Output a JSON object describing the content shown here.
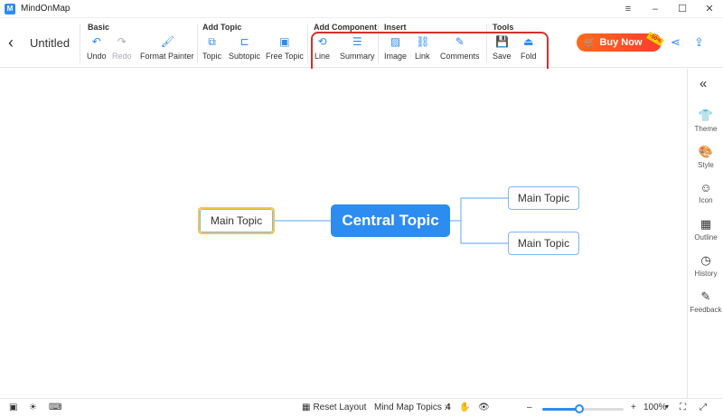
{
  "window": {
    "title": "MindOnMap",
    "logo": "M",
    "controls": [
      "≡",
      "–",
      "☐",
      "✕"
    ]
  },
  "toolbar": {
    "back_icon": "‹",
    "doc_title": "Untitled",
    "groups": {
      "basic": "Basic",
      "add_topic": "Add Topic",
      "add_component": "Add Component",
      "insert": "Insert",
      "tools": "Tools"
    },
    "tools": {
      "undo": "Undo",
      "redo": "Redo",
      "format_painter": "Format Painter",
      "topic": "Topic",
      "subtopic": "Subtopic",
      "free_topic": "Free Topic",
      "line": "Line",
      "summary": "Summary",
      "image": "Image",
      "link": "Link",
      "comments": "Comments",
      "save": "Save",
      "fold": "Fold"
    },
    "buy_now": "Buy Now",
    "discount_badge": "-50%"
  },
  "canvas": {
    "central_topic": "Central Topic",
    "left_topic": "Main Topic",
    "right_topic_1": "Main Topic",
    "right_topic_2": "Main Topic"
  },
  "rightbar": {
    "collapse_icon": "«",
    "items": [
      {
        "label": "Theme",
        "icon": "👕"
      },
      {
        "label": "Style",
        "icon": "🎨"
      },
      {
        "label": "Icon",
        "icon": "☺"
      },
      {
        "label": "Outline",
        "icon": "▦"
      },
      {
        "label": "History",
        "icon": "◷"
      },
      {
        "label": "Feedback",
        "icon": "✎"
      }
    ]
  },
  "statusbar": {
    "reset_layout": "Reset Layout",
    "topics_label": "Mind Map Topics :",
    "topics_count": "4",
    "zoom_minus": "–",
    "zoom_plus": "+",
    "zoom_value": "100%",
    "zoom_fraction": 0.45
  },
  "colors": {
    "accent": "#2d8cf0",
    "highlight": "#d9302b",
    "selected": "#f5c542",
    "buy": "#ff5a22"
  }
}
